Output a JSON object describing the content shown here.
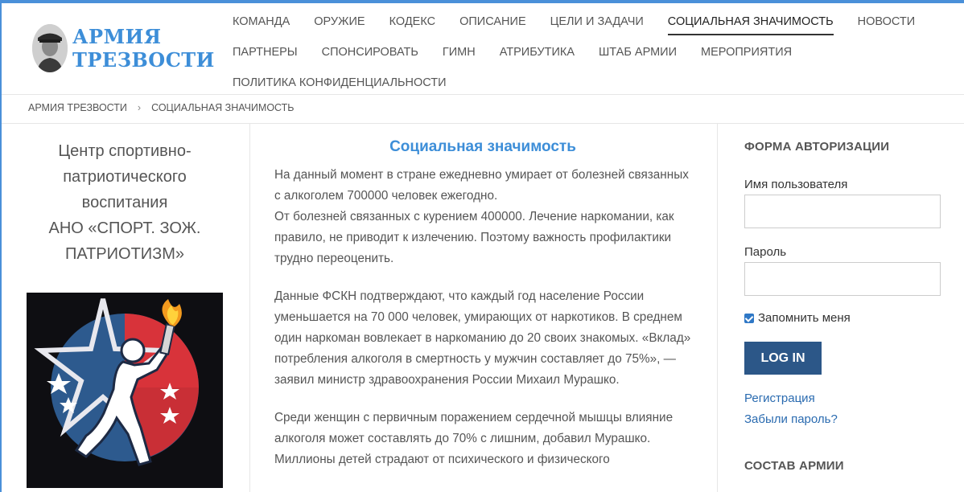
{
  "site": {
    "logo_line1": "АРМИЯ",
    "logo_line2": "ТРЕЗВОСТИ"
  },
  "nav": {
    "rows": [
      [
        "КОМАНДА",
        "ОРУЖИЕ",
        "КОДЕКС",
        "ОПИСАНИЕ",
        "ЦЕЛИ И ЗАДАЧИ",
        "СОЦИАЛЬНАЯ ЗНАЧИМОСТЬ",
        "НОВОСТИ"
      ],
      [
        "ПАРТНЕРЫ",
        "СПОНСИРОВАТЬ",
        "ГИМН",
        "АТРИБУТИКА",
        "ШТАБ АРМИИ",
        "МЕРОПРИЯТИЯ"
      ],
      [
        "ПОЛИТИКА КОНФИДЕНЦИАЛЬНОСТИ"
      ]
    ],
    "active": "СОЦИАЛЬНАЯ ЗНАЧИМОСТЬ"
  },
  "breadcrumb": {
    "home": "АРМИЯ ТРЕЗВОСТИ",
    "separator": "›",
    "current": "СОЦИАЛЬНАЯ ЗНАЧИМОСТЬ"
  },
  "left": {
    "lines": [
      "Центр спортивно-",
      "патриотического",
      "воспитания",
      "АНО «СПОРТ. ЗОЖ.",
      "ПАТРИОТИЗМ»"
    ]
  },
  "article": {
    "title": "Социальная значимость",
    "paragraphs": [
      "На данный момент в стране ежедневно умирает от болезней связанных с алкоголем 700000 человек ежегодно.\nОт болезней связанных с курением 400000. Лечение наркомании, как правило, не приводит к излечению. Поэтому важность профилактики трудно переоценить.",
      "Данные ФСКН подтверждают, что каждый год население России уменьшается на 70 000 человек, умирающих от наркотиков. В среднем один наркоман вовлекает в наркоманию до 20 своих знакомых. «Вклад» потребления алкоголя в смертность у мужчин составляет до 75%», — заявил министр здравоохранения России Михаил Мурашко.",
      "Среди женщин с первичным поражением сердечной мышцы влияние алкоголя может составлять до 70% с лишним, добавил Мурашко. Миллионы детей страдают от психического и физического"
    ]
  },
  "sidebar": {
    "login_title": "ФОРМА АВТОРИЗАЦИИ",
    "username_label": "Имя пользователя",
    "username_value": "",
    "password_label": "Пароль",
    "password_value": "",
    "remember_label": "Запомнить меня",
    "remember_checked": true,
    "login_button": "LOG IN",
    "register_link": "Регистрация",
    "forgot_link": "Забыли пароль?",
    "army_title": "СОСТАВ АРМИИ"
  },
  "colors": {
    "accent": "#3d8ed8",
    "button": "#2c5788",
    "link": "#2a6bb0"
  }
}
